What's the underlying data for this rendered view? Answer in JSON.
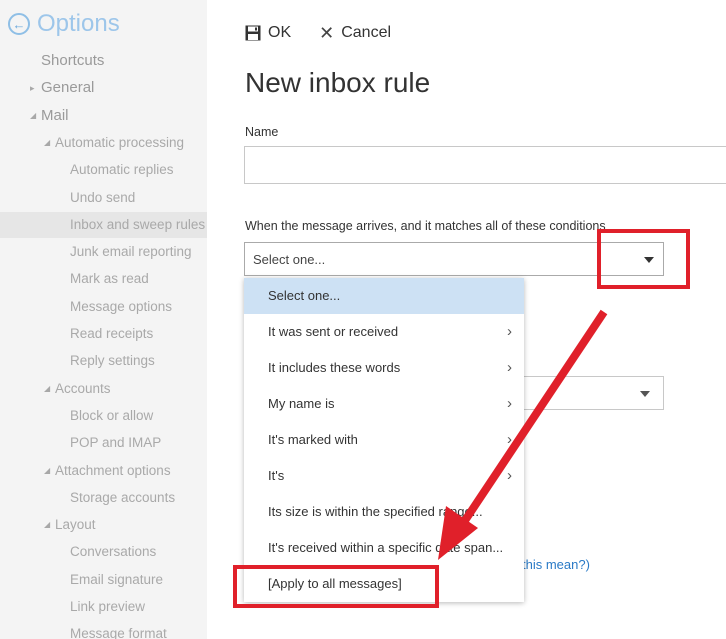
{
  "sidebar": {
    "title": "Options",
    "items": [
      {
        "label": "Shortcuts",
        "level": 0,
        "caret": ""
      },
      {
        "label": "General",
        "level": 0,
        "caret": "right"
      },
      {
        "label": "Mail",
        "level": 0,
        "caret": "down"
      },
      {
        "label": "Automatic processing",
        "level": 1,
        "caret": "down"
      },
      {
        "label": "Automatic replies",
        "level": 2,
        "caret": ""
      },
      {
        "label": "Undo send",
        "level": 2,
        "caret": ""
      },
      {
        "label": "Inbox and sweep rules",
        "level": 2,
        "caret": "",
        "selected": true
      },
      {
        "label": "Junk email reporting",
        "level": 2,
        "caret": ""
      },
      {
        "label": "Mark as read",
        "level": 2,
        "caret": ""
      },
      {
        "label": "Message options",
        "level": 2,
        "caret": ""
      },
      {
        "label": "Read receipts",
        "level": 2,
        "caret": ""
      },
      {
        "label": "Reply settings",
        "level": 2,
        "caret": ""
      },
      {
        "label": "Accounts",
        "level": 1,
        "caret": "down"
      },
      {
        "label": "Block or allow",
        "level": 2,
        "caret": ""
      },
      {
        "label": "POP and IMAP",
        "level": 2,
        "caret": ""
      },
      {
        "label": "Attachment options",
        "level": 1,
        "caret": "down"
      },
      {
        "label": "Storage accounts",
        "level": 2,
        "caret": ""
      },
      {
        "label": "Layout",
        "level": 1,
        "caret": "down"
      },
      {
        "label": "Conversations",
        "level": 2,
        "caret": ""
      },
      {
        "label": "Email signature",
        "level": 2,
        "caret": ""
      },
      {
        "label": "Link preview",
        "level": 2,
        "caret": ""
      },
      {
        "label": "Message format",
        "level": 2,
        "caret": ""
      }
    ]
  },
  "toolbar": {
    "ok_label": "OK",
    "cancel_label": "Cancel"
  },
  "form": {
    "title": "New inbox rule",
    "name_label": "Name",
    "name_value": "",
    "conditions_label": "When the message arrives, and it matches all of these conditions",
    "conditions_selected": "Select one...",
    "help_link": "this mean?)"
  },
  "dropdown": {
    "items": [
      {
        "label": "Select one...",
        "submenu": false,
        "highlighted": true
      },
      {
        "label": "It was sent or received",
        "submenu": true
      },
      {
        "label": "It includes these words",
        "submenu": true
      },
      {
        "label": "My name is",
        "submenu": true
      },
      {
        "label": "It's marked with",
        "submenu": true
      },
      {
        "label": "It's",
        "submenu": true
      },
      {
        "label": "Its size is within the specified range...",
        "submenu": false
      },
      {
        "label": "It's received within a specific date span...",
        "submenu": false
      },
      {
        "label": "[Apply to all messages]",
        "submenu": false
      }
    ]
  },
  "colors": {
    "annotation_red": "#e0202a",
    "highlight_blue": "#cde1f4",
    "sidebar_bg": "#f4f4f4",
    "link_blue": "#2a7ac6"
  }
}
